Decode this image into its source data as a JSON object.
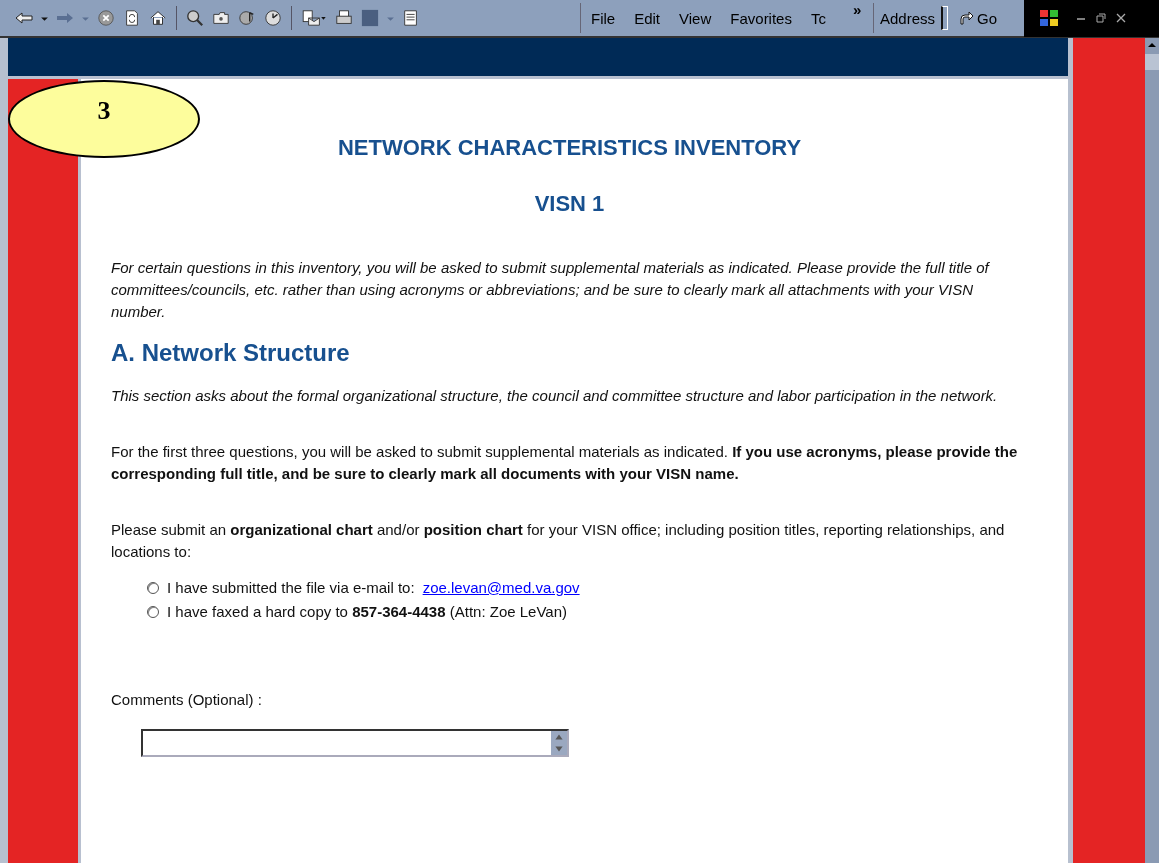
{
  "menu": {
    "items": [
      "File",
      "Edit",
      "View",
      "Favorites",
      "Tc"
    ],
    "chevron": "»",
    "address_label": "Address",
    "go": "Go"
  },
  "badge": "3",
  "page": {
    "title": "NETWORK CHARACTERISTICS INVENTORY",
    "subtitle": "VISN 1",
    "intro": "For certain questions in this inventory, you will be asked to submit supplemental materials as indicated. Please provide the full title of committees/councils, etc. rather than using acronyms or abbreviations; and be sure to clearly mark all attachments with your VISN number.",
    "section_heading": "A. Network Structure",
    "section_intro": "This section asks about the formal organizational structure, the council and committee structure and labor participation in the network.",
    "instructions": "For the first three questions, you will be asked to submit supplemental materials as indicated. **If you use acronyms, please provide the corresponding full title, and be sure to clearly mark all documents with your VISN name.**",
    "question": "Please submit an **organizational chart** and/or **position chart** for your VISN office; including position titles, reporting relationships, and locations to:",
    "options": [
      {
        "text": "I have submitted the file via e-mail to:",
        "link": "zoe.levan@med.va.gov",
        "selected": false
      },
      {
        "text": "I have faxed a hard copy to **857-364-4438** (Attn: Zoe LeVan)",
        "selected": false
      }
    ],
    "comments_label": "Comments (Optional) :"
  }
}
